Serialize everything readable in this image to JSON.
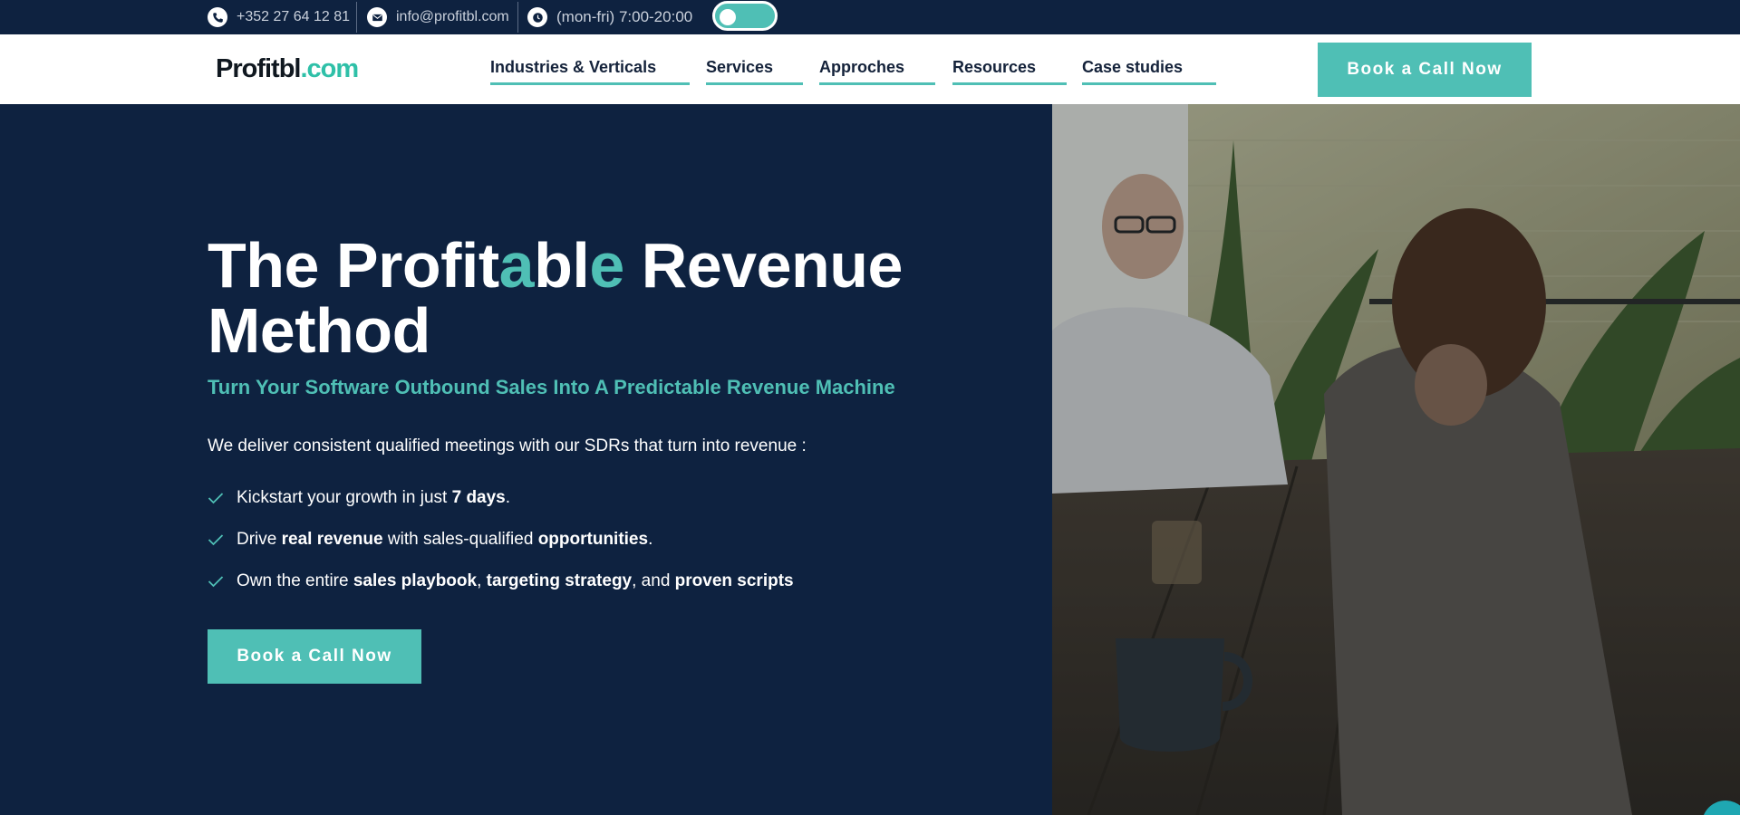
{
  "topbar": {
    "phone": "+352 27 64 12 81",
    "email": "info@profitbl.com",
    "hours": "(mon-fri) 7:00-20:00",
    "phone_icon": "phone-icon",
    "email_icon": "mail-icon",
    "hours_icon": "clock-icon"
  },
  "logo": {
    "name": "Profitbl",
    "tld": ".com"
  },
  "nav": {
    "items": [
      {
        "label": "Industries & Verticals"
      },
      {
        "label": "Services"
      },
      {
        "label": "Approches"
      },
      {
        "label": "Resources"
      },
      {
        "label": "Case studies"
      }
    ],
    "cta": "Book a Call Now"
  },
  "hero": {
    "title_part1": "The Profit",
    "title_hl1": "a",
    "title_mid": "bl",
    "title_hl2": "e",
    "title_part2": " Revenue Method",
    "subtitle": "Turn Your Software Outbound Sales Into A Predictable Revenue Machine",
    "intro": "We deliver consistent qualified meetings with our SDRs that turn into revenue :",
    "bullets": [
      {
        "t1": "Kickstart your growth in just ",
        "b1": "7 days",
        "t2": "."
      },
      {
        "t1": "Drive ",
        "b1": "real revenue",
        "t2": " with sales-qualified ",
        "b2": "opportunities",
        "t3": "."
      },
      {
        "t1": "Own the entire ",
        "b1": "sales playbook",
        "t2": ", ",
        "b2": "targeting strategy",
        "t3": ", and ",
        "b3": "proven scripts"
      }
    ],
    "cta": "Book a Call Now",
    "check_icon": "check-icon"
  },
  "colors": {
    "navy": "#0e2240",
    "teal": "#4fbfb5",
    "white": "#ffffff"
  }
}
